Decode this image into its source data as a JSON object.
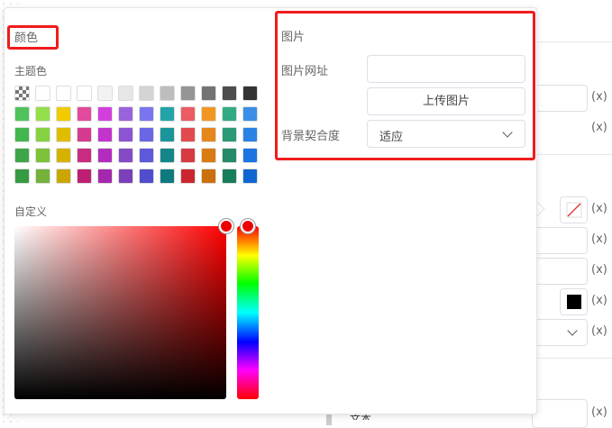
{
  "color_section": {
    "title": "颜色",
    "theme_label": "主题色",
    "custom_label": "自定义",
    "swatches": [
      [
        "checker",
        "#ffffff",
        "#ffffff",
        "#ffffff",
        "#f2f2f2",
        "#e6e6e6",
        "#d4d4d4",
        "#bdbdbd",
        "#959595",
        "#737373",
        "#4d4d4d",
        "#333333"
      ],
      [
        "#4fc35a",
        "#94e04a",
        "#efcb00",
        "#e24a9b",
        "#d23fdc",
        "#9b62de",
        "#7a75ef",
        "#21a3a8",
        "#ec5c63",
        "#f29623",
        "#33aa84",
        "#3a8ee8"
      ],
      [
        "#43b64e",
        "#86d13f",
        "#e0bc00",
        "#d63a8d",
        "#c234cc",
        "#8d54d2",
        "#6a66e6",
        "#1a9599",
        "#e24a50",
        "#e5871a",
        "#2a9a77",
        "#2a82e4"
      ],
      [
        "#3da649",
        "#7ec23b",
        "#d5b200",
        "#c92c7f",
        "#b22dbd",
        "#854ac6",
        "#5e58db",
        "#148689",
        "#d73a43",
        "#da7a12",
        "#258a6a",
        "#1b74e2"
      ],
      [
        "#369a43",
        "#74b23a",
        "#c9a700",
        "#bd1f72",
        "#a428ae",
        "#7c41b8",
        "#524ccf",
        "#0f7a7d",
        "#cb262f",
        "#cc6f0e",
        "#177e5c",
        "#1066d0"
      ]
    ],
    "selected_color": "#ff0000"
  },
  "image_section": {
    "title": "图片",
    "url_label": "图片网址",
    "url_value": "",
    "upload_label": "上传图片",
    "fit_label": "背景契合度",
    "fit_value": "适应"
  },
  "background_panel": {
    "var_label": "(x)",
    "bottom_text": "文本"
  }
}
